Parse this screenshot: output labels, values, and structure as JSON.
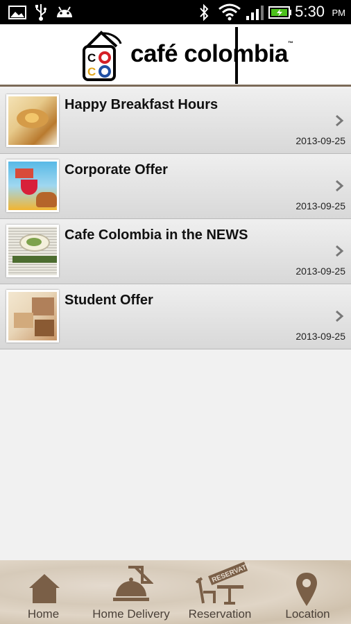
{
  "status_bar": {
    "time": "5:30",
    "ampm": "PM",
    "icons": [
      "image-icon",
      "usb-icon",
      "android-icon",
      "bluetooth-icon",
      "wifi-icon",
      "signal-icon",
      "battery-charging-icon"
    ]
  },
  "header": {
    "brand_name": "café colombia",
    "trademark": "™",
    "logo_letters": [
      "CO",
      "CO"
    ]
  },
  "offers": [
    {
      "title": "Happy Breakfast Hours",
      "date": "2013-09-25",
      "thumb_colors": [
        "#e7c98a",
        "#b97a2e"
      ]
    },
    {
      "title": "Corporate Offer",
      "date": "2013-09-25",
      "thumb_colors": [
        "#d84a3a",
        "#f2b531"
      ]
    },
    {
      "title": "Cafe Colombia in the NEWS",
      "date": "2013-09-25",
      "thumb_colors": [
        "#d9d7cc",
        "#5b8a3a"
      ]
    },
    {
      "title": "Student Offer",
      "date": "2013-09-25",
      "thumb_colors": [
        "#e9d6b8",
        "#8a5a33"
      ]
    }
  ],
  "tabs": [
    {
      "label": "Home",
      "icon": "home-icon"
    },
    {
      "label": "Home Delivery",
      "icon": "delivery-icon"
    },
    {
      "label": "Reservation",
      "icon": "reservation-icon",
      "badge": "RESERVATION"
    },
    {
      "label": "Location",
      "icon": "location-pin-icon"
    }
  ],
  "colors": {
    "tab_icon": "#7a5f47",
    "header_border": "#7b6a58"
  }
}
